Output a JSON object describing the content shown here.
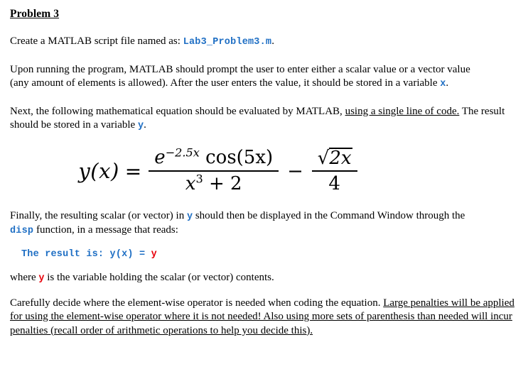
{
  "document": {
    "title": "Problem 3",
    "paragraphs": {
      "p1_before_code": "Create a MATLAB script file named as:",
      "p1_code": "Lab3_Problem3.m",
      "p1_after_code": ".",
      "p2_line1": "Upon running the program, MATLAB should prompt the user to enter either a scalar value or a vector value",
      "p2_line2_a": "(any amount of elements is allowed). After the user enters the value, it should be stored in a variable",
      "p2_var": "x",
      "p2_line2_b": ".",
      "p3_a": "Next, the following mathematical equation should be evaluated by MATLAB,",
      "p3_underlined": "using a single line of code.",
      "p3_b": "The result should be stored in a variable",
      "p3_var": "y",
      "p3_c": ".",
      "p4_a": "Finally, the resulting scalar (or vector) in",
      "p4_var": "y",
      "p4_b": "should then be displayed in the Command Window through the",
      "p4_code": "disp",
      "p4_c": "function, in a message that reads:",
      "p5_a": "where",
      "p5_var": "y",
      "p5_b": "is the variable holding the scalar (or vector) contents.",
      "p6_plain": "Carefully decide where the element-wise operator is needed when coding the equation.",
      "p6_underlined": "Large penalties will be applied for using the element-wise operator where it is not needed! Also using more sets of parenthesis than needed will incur penalties (recall order of arithmetic operations to help you decide this)."
    },
    "code_sample": {
      "text_blue_prefix": "The result is: y(x) = ",
      "text_red_var": "y"
    },
    "equation": {
      "lhs": "y(x)",
      "equals": "=",
      "numerator_exp_base": "e",
      "numerator_exp_power": "−2.5x",
      "numerator_cos": "cos(5x)",
      "denominator_base": "x",
      "denominator_power": "3",
      "denominator_rest": "+ 2",
      "operator": "−",
      "sqrt_symbol": "√",
      "sqrt_radicand": "2x",
      "right_denominator": "4",
      "plain_text": "y(x) = e^(-2.5x) cos(5x) / (x^3 + 2) - sqrt(2x) / 4"
    },
    "colors": {
      "code_blue": "#1F6FC4",
      "code_red": "#E8000B",
      "text_black": "#000000",
      "page_background": "#FFFFFF"
    }
  }
}
